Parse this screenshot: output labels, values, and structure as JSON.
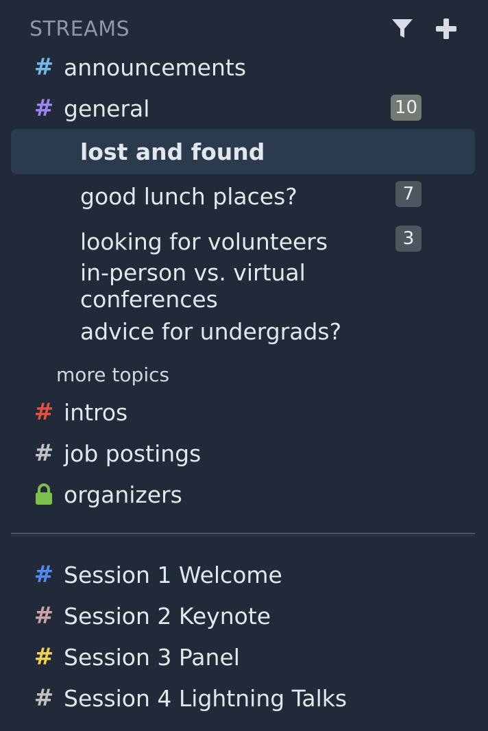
{
  "header": {
    "title": "STREAMS",
    "filter_icon": "filter-icon",
    "add_icon": "plus-icon"
  },
  "streams": [
    {
      "name": "announcements",
      "color": "#76b7e6",
      "icon": "hash-icon"
    },
    {
      "name": "general",
      "color": "#9e86f0",
      "icon": "hash-icon",
      "unread": "10"
    },
    {
      "name": "intros",
      "color": "#e4523d",
      "icon": "hash-icon"
    },
    {
      "name": "job postings",
      "color": "#c2c2c2",
      "icon": "hash-icon"
    },
    {
      "name": "organizers",
      "color": "#7bc04b",
      "icon": "lock-icon"
    }
  ],
  "topics": [
    {
      "name": "lost and found",
      "selected": true
    },
    {
      "name": "good lunch places?",
      "unread": "7"
    },
    {
      "name": "looking for volunteers",
      "unread": "3"
    },
    {
      "name": "in-person vs. virtual conferences"
    },
    {
      "name": "advice for undergrads?"
    }
  ],
  "more_topics_label": "more topics",
  "sessions": [
    {
      "name": "Session 1 Welcome",
      "color": "#4f8cf0",
      "icon": "hash-icon"
    },
    {
      "name": "Session 2 Keynote",
      "color": "#c9a3a8",
      "icon": "hash-icon"
    },
    {
      "name": "Session 3 Panel",
      "color": "#f1d14b",
      "icon": "hash-icon"
    },
    {
      "name": "Session 4 Lightning Talks",
      "color": "#c2c2c2",
      "icon": "hash-icon"
    }
  ],
  "colors": {
    "background": "#212a39",
    "selected_row": "#2b3b4d",
    "badge": "#4e5660",
    "badge_highlight": "#737a72"
  }
}
